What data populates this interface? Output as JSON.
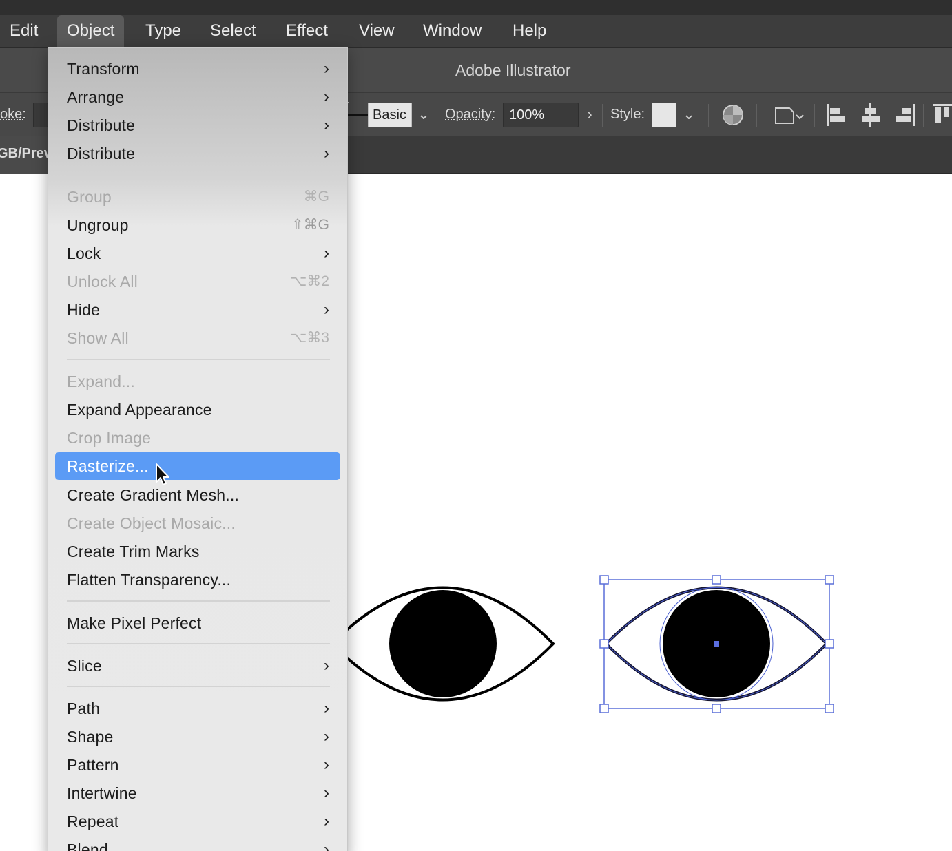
{
  "app": {
    "title": "Adobe Illustrator"
  },
  "menubar": {
    "items": [
      {
        "label": "Edit"
      },
      {
        "label": "Object",
        "active": true
      },
      {
        "label": "Type"
      },
      {
        "label": "Select"
      },
      {
        "label": "Effect"
      },
      {
        "label": "View"
      },
      {
        "label": "Window"
      },
      {
        "label": "Help"
      }
    ]
  },
  "control_bar": {
    "stroke_label": "oke:",
    "brush_label": "Basic",
    "opacity_label": "Opacity:",
    "opacity_value": "100%",
    "style_label": "Style:"
  },
  "doc_tab": {
    "label": "GB/Prev"
  },
  "object_menu": {
    "items": [
      {
        "label": "Transform",
        "submenu": true,
        "enabled": true
      },
      {
        "label": "Arrange",
        "submenu": true,
        "enabled": true
      },
      {
        "label": "Distribute",
        "submenu": true,
        "enabled": true
      },
      {
        "label": "Distribute",
        "submenu": true,
        "enabled": true
      },
      {
        "label": "Group",
        "shortcut": "⌘G",
        "enabled": false
      },
      {
        "label": "Ungroup",
        "shortcut": "⇧⌘G",
        "enabled": true
      },
      {
        "label": "Lock",
        "submenu": true,
        "enabled": true
      },
      {
        "label": "Unlock All",
        "shortcut": "⌥⌘2",
        "enabled": false
      },
      {
        "label": "Hide",
        "submenu": true,
        "enabled": true
      },
      {
        "label": "Show All",
        "shortcut": "⌥⌘3",
        "enabled": false
      },
      {
        "label": "Expand...",
        "enabled": false
      },
      {
        "label": "Expand Appearance",
        "enabled": true
      },
      {
        "label": "Crop Image",
        "enabled": false
      },
      {
        "label": "Rasterize...",
        "enabled": true,
        "highlighted": true
      },
      {
        "label": "Create Gradient Mesh...",
        "enabled": true
      },
      {
        "label": "Create Object Mosaic...",
        "enabled": false
      },
      {
        "label": "Create Trim Marks",
        "enabled": true
      },
      {
        "label": "Flatten Transparency...",
        "enabled": true
      },
      {
        "label": "Make Pixel Perfect",
        "enabled": true
      },
      {
        "label": "Slice",
        "submenu": true,
        "enabled": true
      },
      {
        "label": "Path",
        "submenu": true,
        "enabled": true
      },
      {
        "label": "Shape",
        "submenu": true,
        "enabled": true
      },
      {
        "label": "Pattern",
        "submenu": true,
        "enabled": true
      },
      {
        "label": "Intertwine",
        "submenu": true,
        "enabled": true
      },
      {
        "label": "Repeat",
        "submenu": true,
        "enabled": true
      },
      {
        "label": "Blend",
        "submenu": true,
        "enabled": true
      }
    ]
  },
  "colors": {
    "menubar_bg": "#3d3d3d",
    "highlight": "#5b9bf5",
    "selection": "#4a5fd0"
  },
  "icons": [
    "chevron-right-icon",
    "chevron-down-icon",
    "recolor-icon",
    "artboard-icon",
    "align-left-icon",
    "align-center-icon",
    "align-right-icon",
    "align-top-icon",
    "cursor-icon"
  ]
}
